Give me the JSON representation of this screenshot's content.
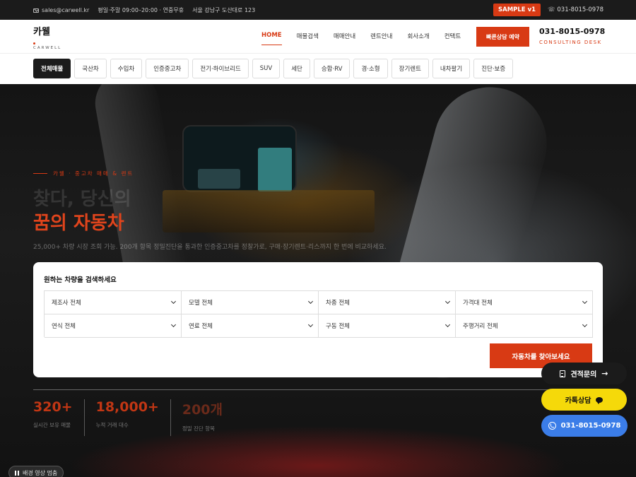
{
  "topbar": {
    "email": "sales@carwell.kr",
    "hours": "평일·주말 09:00–20:00 · 연중무휴",
    "address": "서울 강남구 도산대로 123",
    "badge": "SAMPLE v1",
    "phone": "031-8015-0978"
  },
  "header": {
    "logo": "카웰",
    "logo_sub": "CARWELL",
    "nav": [
      "HOME",
      "매물검색",
      "매매안내",
      "렌트안내",
      "회사소개",
      "컨택트"
    ],
    "active_nav": "HOME",
    "quick_button": "빠른상담 예약",
    "consult_phone": "031-8015-0978",
    "consult_sub": "CONSULTING DESK"
  },
  "categories": [
    "전체매물",
    "국산차",
    "수입차",
    "인증중고차",
    "전기·하이브리드",
    "SUV",
    "세단",
    "승합·RV",
    "경·소형",
    "장기렌트",
    "내차팔기",
    "진단·보증"
  ],
  "hero": {
    "eyebrow": "카웰 · 중고차 매매 & 렌트",
    "line1": "찾다, 당신의",
    "line2": "꿈의 자동차",
    "description": "25,000+ 차량 시장 조회 가능. 200개 항목 정밀진단을 통과한 인증중고차를 정찰가로, 구매·장기렌트·리스까지 한 번에 비교하세요."
  },
  "search": {
    "title": "원하는 차량을 검색하세요",
    "selects": [
      "제조사 전체",
      "모델 전체",
      "차종 전체",
      "가격대 전체",
      "연식 전체",
      "연료 전체",
      "구동 전체",
      "주행거리 전체"
    ],
    "button": "자동차를 찾아보세요"
  },
  "stats": [
    {
      "value": "320+",
      "label": "실시간 보유 매물"
    },
    {
      "value": "18,000+",
      "label": "누적 거래 대수"
    },
    {
      "value": "200개",
      "label": "정밀 진단 항목"
    }
  ],
  "video_toggle": "배경 영상 멈춤",
  "floating": {
    "quote": "견적문의",
    "kakao": "카톡상담",
    "phone": "031-8015-0978"
  },
  "colors": {
    "accent": "#d83a14",
    "dark": "#1b1b1b",
    "kakao": "#f5d90a",
    "phone_button": "#3b7de8"
  },
  "icons": [
    "mail-icon",
    "phone-icon",
    "chevron-down-icon",
    "document-icon",
    "arrow-right-icon",
    "chat-icon",
    "pause-icon"
  ]
}
